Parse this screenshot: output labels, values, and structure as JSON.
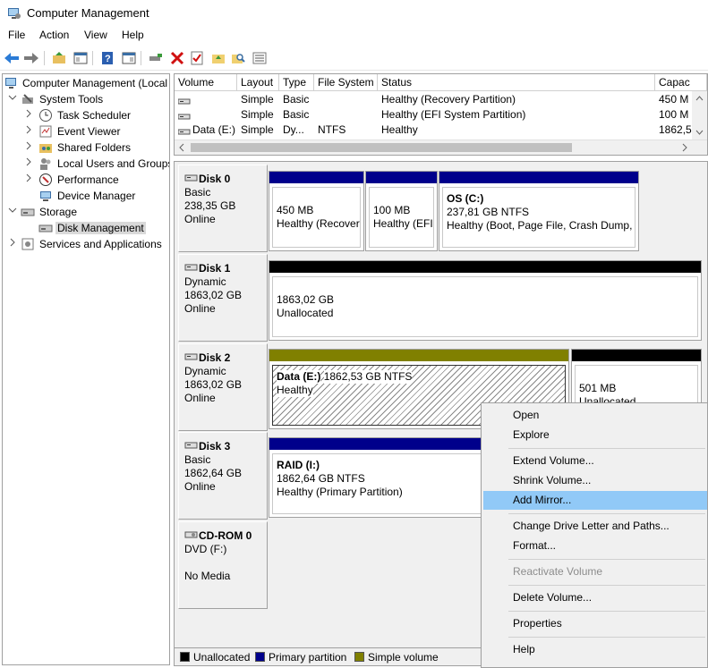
{
  "window": {
    "title": "Computer Management"
  },
  "menu": [
    "File",
    "Action",
    "View",
    "Help"
  ],
  "tree": [
    {
      "label": "Computer Management (Local",
      "indent": 0,
      "chev": "",
      "icon": "computer-management-icon"
    },
    {
      "label": "System Tools",
      "indent": 1,
      "chev": "v",
      "icon": "tools-icon"
    },
    {
      "label": "Task Scheduler",
      "indent": 2,
      "chev": ">",
      "icon": "clock-icon"
    },
    {
      "label": "Event Viewer",
      "indent": 2,
      "chev": ">",
      "icon": "event-viewer-icon"
    },
    {
      "label": "Shared Folders",
      "indent": 2,
      "chev": ">",
      "icon": "shared-folder-icon"
    },
    {
      "label": "Local Users and Groups",
      "indent": 2,
      "chev": ">",
      "icon": "users-icon"
    },
    {
      "label": "Performance",
      "indent": 2,
      "chev": ">",
      "icon": "performance-icon"
    },
    {
      "label": "Device Manager",
      "indent": 2,
      "chev": "",
      "icon": "device-manager-icon"
    },
    {
      "label": "Storage",
      "indent": 1,
      "chev": "v",
      "icon": "storage-icon"
    },
    {
      "label": "Disk Management",
      "indent": 2,
      "chev": "",
      "icon": "disk-icon",
      "selected": true
    },
    {
      "label": "Services and Applications",
      "indent": 1,
      "chev": ">",
      "icon": "services-icon"
    }
  ],
  "volume_list": {
    "columns": [
      "Volume",
      "Layout",
      "Type",
      "File System",
      "Status",
      "Capac"
    ],
    "rows": [
      [
        "",
        "Simple",
        "Basic",
        "",
        "Healthy (Recovery Partition)",
        "450 M"
      ],
      [
        "",
        "Simple",
        "Basic",
        "",
        "Healthy (EFI System Partition)",
        "100 M"
      ],
      [
        "Data (E:)",
        "Simple",
        "Dy...",
        "NTFS",
        "Healthy",
        "1862,5"
      ]
    ]
  },
  "disks": [
    {
      "name": "Disk 0",
      "type": "Basic",
      "size": "238,35 GB",
      "status": "Online"
    },
    {
      "name": "Disk 1",
      "type": "Dynamic",
      "size": "1863,02 GB",
      "status": "Online"
    },
    {
      "name": "Disk 2",
      "type": "Dynamic",
      "size": "1863,02 GB",
      "status": "Online"
    },
    {
      "name": "Disk 3",
      "type": "Basic",
      "size": "1862,64 GB",
      "status": "Online"
    },
    {
      "name": "CD-ROM 0",
      "type": "DVD (F:)",
      "size": "",
      "status": "No Media"
    }
  ],
  "partitions": {
    "d0p1": {
      "name": "",
      "size": "450 MB",
      "status": "Healthy (Recovery"
    },
    "d0p2": {
      "name": "",
      "size": "100 MB",
      "status": "Healthy (EFI"
    },
    "d0p3": {
      "name": "OS  (C:)",
      "size": "237,81 GB NTFS",
      "status": "Healthy (Boot, Page File, Crash Dump, P"
    },
    "d1p1": {
      "name": "",
      "size": "1863,02 GB",
      "status": "Unallocated"
    },
    "d2p1": {
      "name": "Data  (E:)",
      "size": "1862,53 GB NTFS",
      "status": "Healthy"
    },
    "d2p2": {
      "name": "",
      "size": "501 MB",
      "status": "Unallocated"
    },
    "d3p1": {
      "name": "RAID  (I:)",
      "size": "1862,64 GB NTFS",
      "status": "Healthy (Primary Partition)"
    }
  },
  "legend": [
    {
      "label": "Unallocated",
      "color": "#000000"
    },
    {
      "label": "Primary partition",
      "color": "#00008b"
    },
    {
      "label": "Simple volume",
      "color": "#808000"
    }
  ],
  "colors": {
    "primary": "#00008b",
    "unallocated": "#000000",
    "simple": "#808000",
    "highlight": "#91c9f7"
  },
  "context_menu": {
    "open": "Open",
    "explore": "Explore",
    "extend": "Extend Volume...",
    "shrink": "Shrink Volume...",
    "add_mirror": "Add Mirror...",
    "change_letter": "Change Drive Letter and Paths...",
    "format": "Format...",
    "reactivate": "Reactivate Volume",
    "delete": "Delete Volume...",
    "properties": "Properties",
    "help": "Help"
  }
}
